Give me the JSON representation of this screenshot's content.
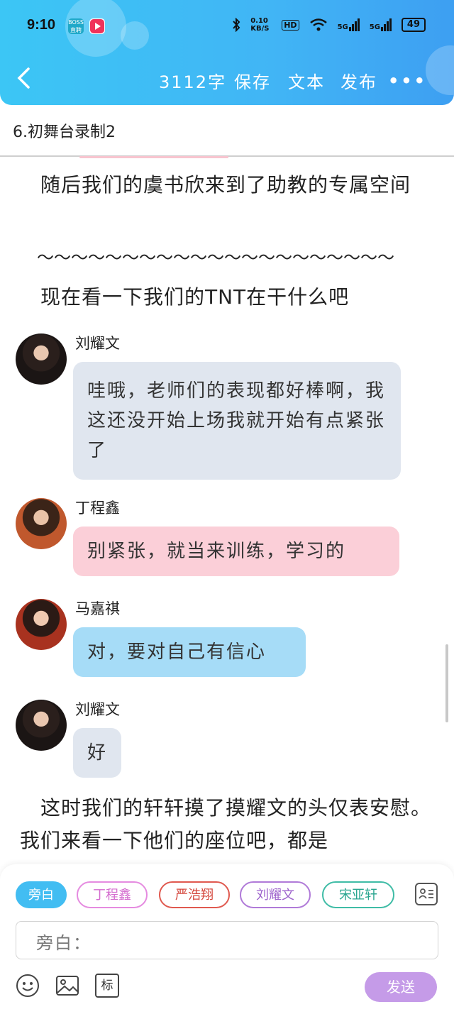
{
  "status_bar": {
    "time": "9:10",
    "app1_label": "BOSS 直聘",
    "network_speed": "0.10 KB/S",
    "hd": "HD",
    "signal1": "5G",
    "signal2": "5G",
    "battery": "49"
  },
  "nav": {
    "word_count": "3112字",
    "save": "保存",
    "text": "文本",
    "publish": "发布",
    "more": "•••"
  },
  "chapter_title": "6.初舞台录制2",
  "content": {
    "para1": "　随后我们的虞书欣来到了助教的专属空间",
    "para2": "　～～～～～～～～～～～～～～～～～～～～～",
    "para3": "　现在看一下我们的TNT在干什么吧",
    "para4": "　这时我们的轩轩摸了摸耀文的头仅表安慰。我们来看一下他们的座位吧，都是"
  },
  "messages": [
    {
      "name": "刘耀文",
      "text": "哇哦，老师们的表现都好棒啊，我这还没开始上场我就开始有点紧张了"
    },
    {
      "name": "丁程鑫",
      "text": "别紧张，就当来训练，学习的"
    },
    {
      "name": "马嘉祺",
      "text": "对，要对自己有信心"
    },
    {
      "name": "刘耀文",
      "text": "好"
    }
  ],
  "roles": [
    "旁白",
    "丁程鑫",
    "严浩翔",
    "刘耀文",
    "宋亚轩"
  ],
  "input": {
    "prefix": "旁白："
  },
  "toolbar": {
    "mark_label": "标",
    "send_label": "发送"
  },
  "colors": {
    "header": "#3cc6f5",
    "bubble_grey": "#e0e6ef",
    "bubble_pink": "#fbcfd8",
    "bubble_blue": "#a6dcf7",
    "send": "#c59be8"
  }
}
